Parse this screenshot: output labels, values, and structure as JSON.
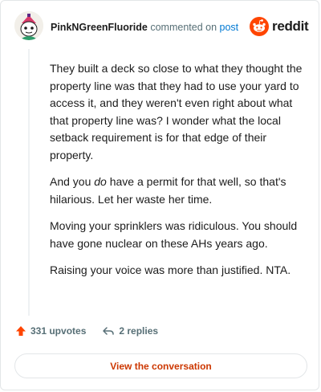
{
  "header": {
    "username": "PinkNGreenFluoride",
    "action_text": "commented on",
    "post_link_text": "post",
    "brand_name": "reddit"
  },
  "comment": {
    "paragraphs": [
      "They built a deck so close to what they thought the property line was that they had to use your yard to access it, and they weren't even right about what that property line was? I wonder what the local setback requirement is for that edge of their property.",
      "",
      "Moving your sprinklers was ridiculous. You should have gone nuclear on these AHs years ago.",
      "Raising your voice was more than justified. NTA."
    ],
    "paragraph2_before": "And you ",
    "paragraph2_emphasis": "do",
    "paragraph2_after": " have a permit for that well, so that's hilarious. Let her waste her time."
  },
  "footer": {
    "upvotes": "331 upvotes",
    "replies": "2 replies",
    "view_button": "View the conversation"
  },
  "colors": {
    "brand": "#ff4500",
    "upvote": "#ff4500",
    "link": "#0079d3",
    "muted": "#576f76",
    "button_text": "#cc3700"
  },
  "icons": {
    "avatar": "snoo-avatar-icon",
    "brand": "reddit-logo-icon",
    "upvote": "upvote-arrow-icon",
    "reply": "reply-arrow-icon"
  }
}
